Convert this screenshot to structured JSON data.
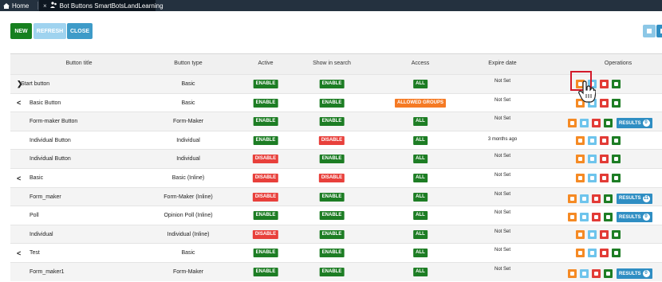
{
  "tabs": {
    "home_label": "Home",
    "active_label": "Bot Buttons SmartBotsLandLearning",
    "close_glyph": "×"
  },
  "toolbar": {
    "new": "NEW",
    "refresh": "REFRESH",
    "close": "CLOSE"
  },
  "columns": [
    "Button title",
    "Button type",
    "Active",
    "Show in search",
    "Access",
    "Expire date",
    "Operations"
  ],
  "rows": [
    {
      "title": "Start button",
      "type": "Basic",
      "active": "ENABLE",
      "search": "ENABLE",
      "access": "ALL",
      "expire": "Not Set",
      "chevron": "❯",
      "results": null
    },
    {
      "title": "Basic Button",
      "type": "Basic",
      "active": "ENABLE",
      "search": "ENABLE",
      "access": "ALLOWED GROUPS",
      "expire": "Not Set",
      "chevron": "<",
      "results": null
    },
    {
      "title": "Form-maker Button",
      "type": "Form-Maker",
      "active": "ENABLE",
      "search": "ENABLE",
      "access": "ALL",
      "expire": "Not Set",
      "chevron": "",
      "results": {
        "label": "RESULTS",
        "count": "0"
      }
    },
    {
      "title": "Individual Button",
      "type": "Individual",
      "active": "ENABLE",
      "search": "DISABLE",
      "access": "ALL",
      "expire": "3 months ago",
      "chevron": "",
      "results": null
    },
    {
      "title": "Individual Button",
      "type": "Individual",
      "active": "DISABLE",
      "search": "ENABLE",
      "access": "ALL",
      "expire": "Not Set",
      "chevron": "",
      "results": null
    },
    {
      "title": "Basic",
      "type": "Basic (Inline)",
      "active": "DISABLE",
      "search": "DISABLE",
      "access": "ALL",
      "expire": "Not Set",
      "chevron": "<",
      "results": null
    },
    {
      "title": "Form_maker",
      "type": "Form-Maker (Inline)",
      "active": "DISABLE",
      "search": "ENABLE",
      "access": "ALL",
      "expire": "Not Set",
      "chevron": "",
      "results": {
        "label": "RESULTS",
        "count": "11"
      }
    },
    {
      "title": "Poll",
      "type": "Opinion Poll (Inline)",
      "active": "ENABLE",
      "search": "ENABLE",
      "access": "ALL",
      "expire": "Not Set",
      "chevron": "",
      "results": {
        "label": "RESULTS",
        "count": "0"
      }
    },
    {
      "title": "Individual",
      "type": "Individual (Inline)",
      "active": "DISABLE",
      "search": "ENABLE",
      "access": "ALL",
      "expire": "Not Set",
      "chevron": "",
      "results": null
    },
    {
      "title": "Test",
      "type": "Basic",
      "active": "ENABLE",
      "search": "ENABLE",
      "access": "ALL",
      "expire": "Not Set",
      "chevron": "<",
      "results": null
    },
    {
      "title": "Form_maker1",
      "type": "Form-Maker",
      "active": "ENABLE",
      "search": "ENABLE",
      "access": "ALL",
      "expire": "Not Set",
      "chevron": "",
      "results": {
        "label": "RESULTS",
        "count": "0"
      }
    }
  ],
  "colors": {
    "enable": "#1d7d24",
    "disable": "#e8403b",
    "allowed_groups": "#f57a24",
    "results": "#2f8ec3"
  },
  "icons": {
    "edit": "pencil-icon",
    "copy": "copy-icon",
    "delete": "trash-icon",
    "chat": "chat-icon",
    "cursor": "hand-pointer-icon"
  }
}
